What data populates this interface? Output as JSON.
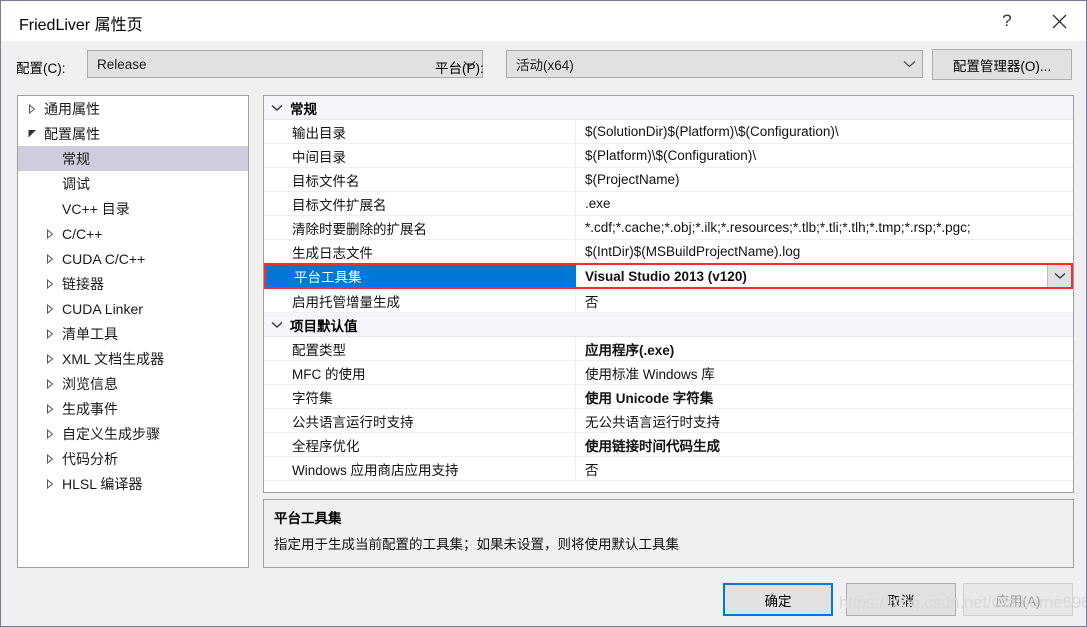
{
  "window": {
    "title": "FriedLiver 属性页",
    "help_icon": "?",
    "close_icon": "close-icon"
  },
  "config_bar": {
    "config_label": "配置(C):",
    "config_value": "Release",
    "platform_label": "平台(P):",
    "platform_value": "活动(x64)",
    "config_manager_button": "配置管理器(O)..."
  },
  "tree": {
    "items": [
      {
        "label": "通用属性",
        "level": 0,
        "arrow": "collapsed",
        "selected": false
      },
      {
        "label": "配置属性",
        "level": 0,
        "arrow": "expanded",
        "selected": false
      },
      {
        "label": "常规",
        "level": 1,
        "arrow": "none",
        "selected": true
      },
      {
        "label": "调试",
        "level": 1,
        "arrow": "none",
        "selected": false
      },
      {
        "label": "VC++ 目录",
        "level": 1,
        "arrow": "none",
        "selected": false
      },
      {
        "label": "C/C++",
        "level": 1,
        "arrow": "collapsed",
        "selected": false
      },
      {
        "label": "CUDA C/C++",
        "level": 1,
        "arrow": "collapsed",
        "selected": false
      },
      {
        "label": "链接器",
        "level": 1,
        "arrow": "collapsed",
        "selected": false
      },
      {
        "label": "CUDA Linker",
        "level": 1,
        "arrow": "collapsed",
        "selected": false
      },
      {
        "label": "清单工具",
        "level": 1,
        "arrow": "collapsed",
        "selected": false
      },
      {
        "label": "XML 文档生成器",
        "level": 1,
        "arrow": "collapsed",
        "selected": false
      },
      {
        "label": "浏览信息",
        "level": 1,
        "arrow": "collapsed",
        "selected": false
      },
      {
        "label": "生成事件",
        "level": 1,
        "arrow": "collapsed",
        "selected": false
      },
      {
        "label": "自定义生成步骤",
        "level": 1,
        "arrow": "collapsed",
        "selected": false
      },
      {
        "label": "代码分析",
        "level": 1,
        "arrow": "collapsed",
        "selected": false
      },
      {
        "label": "HLSL 编译器",
        "level": 1,
        "arrow": "collapsed",
        "selected": false
      }
    ]
  },
  "grid": {
    "groups": [
      {
        "name": "常规",
        "expanded": true,
        "rows": [
          {
            "name": "输出目录",
            "value": "$(SolutionDir)$(Platform)\\$(Configuration)\\",
            "bold": false,
            "selected": false
          },
          {
            "name": "中间目录",
            "value": "$(Platform)\\$(Configuration)\\",
            "bold": false,
            "selected": false
          },
          {
            "name": "目标文件名",
            "value": "$(ProjectName)",
            "bold": false,
            "selected": false
          },
          {
            "name": "目标文件扩展名",
            "value": ".exe",
            "bold": false,
            "selected": false
          },
          {
            "name": "清除时要删除的扩展名",
            "value": "*.cdf;*.cache;*.obj;*.ilk;*.resources;*.tlb;*.tli;*.tlh;*.tmp;*.rsp;*.pgc;",
            "bold": false,
            "selected": false
          },
          {
            "name": "生成日志文件",
            "value": "$(IntDir)$(MSBuildProjectName).log",
            "bold": false,
            "selected": false
          },
          {
            "name": "平台工具集",
            "value": "Visual Studio 2013 (v120)",
            "bold": true,
            "selected": true
          },
          {
            "name": "启用托管增量生成",
            "value": "否",
            "bold": false,
            "selected": false
          }
        ]
      },
      {
        "name": "项目默认值",
        "expanded": true,
        "rows": [
          {
            "name": "配置类型",
            "value": "应用程序(.exe)",
            "bold": true,
            "selected": false
          },
          {
            "name": "MFC 的使用",
            "value": "使用标准 Windows 库",
            "bold": false,
            "selected": false
          },
          {
            "name": "字符集",
            "value": "使用 Unicode 字符集",
            "bold": true,
            "selected": false
          },
          {
            "name": "公共语言运行时支持",
            "value": "无公共语言运行时支持",
            "bold": false,
            "selected": false
          },
          {
            "name": "全程序优化",
            "value": "使用链接时间代码生成",
            "bold": true,
            "selected": false
          },
          {
            "name": "Windows 应用商店应用支持",
            "value": "否",
            "bold": false,
            "selected": false
          }
        ]
      }
    ]
  },
  "description": {
    "title": "平台工具集",
    "body": "指定用于生成当前配置的工具集；如果未设置，则将使用默认工具集"
  },
  "footer": {
    "ok": "确定",
    "cancel": "取消",
    "apply": "应用(A)"
  },
  "watermark": "https://blog.csdn.net/Claiborne696",
  "colors": {
    "accent": "#0078d7",
    "highlight_border": "#fa2d2d",
    "tree_selection": "#cdcdde",
    "dialog_bg": "#f0f0f0"
  }
}
